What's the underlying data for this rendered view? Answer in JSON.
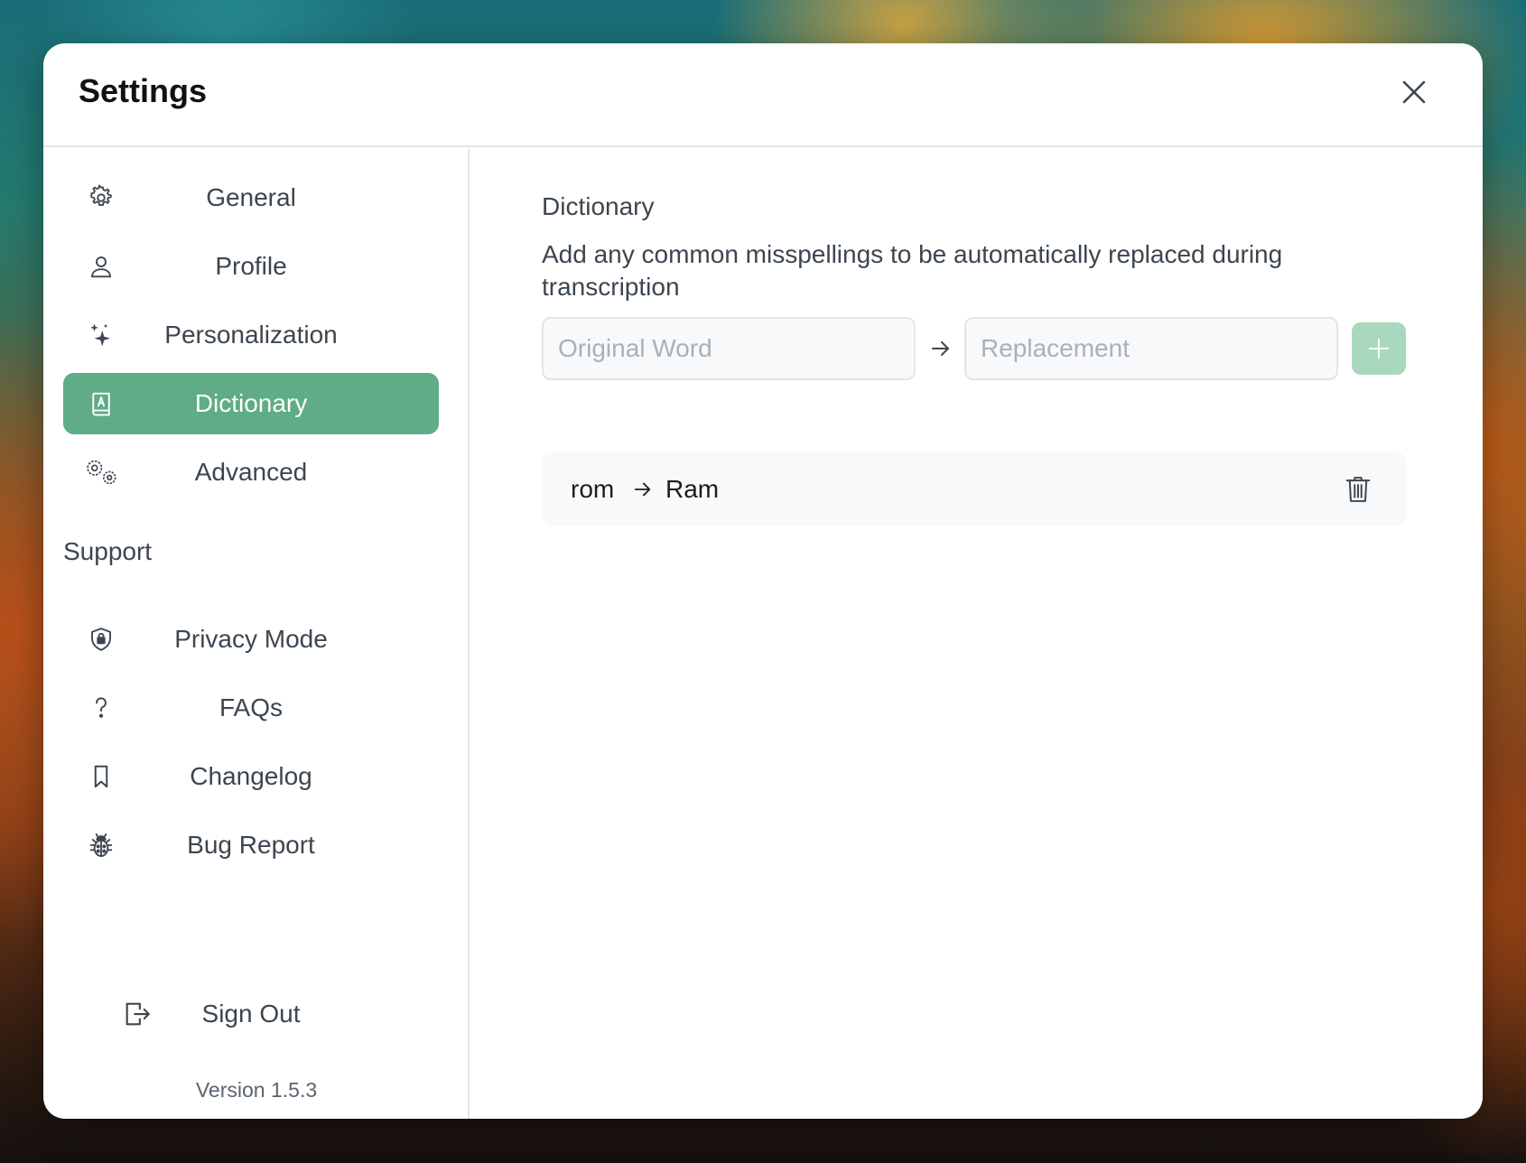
{
  "window": {
    "title": "Settings"
  },
  "sidebar": {
    "items": [
      {
        "label": "General",
        "icon": "gear-icon"
      },
      {
        "label": "Profile",
        "icon": "user-icon"
      },
      {
        "label": "Personalization",
        "icon": "sparkles-icon"
      },
      {
        "label": "Dictionary",
        "icon": "dictionary-book-icon",
        "active": true
      },
      {
        "label": "Advanced",
        "icon": "gears-icon"
      }
    ],
    "support_heading": "Support",
    "support_items": [
      {
        "label": "Privacy Mode",
        "icon": "shield-lock-icon"
      },
      {
        "label": "FAQs",
        "icon": "question-icon"
      },
      {
        "label": "Changelog",
        "icon": "bookmark-icon"
      },
      {
        "label": "Bug Report",
        "icon": "bug-icon"
      }
    ],
    "sign_out": {
      "label": "Sign Out",
      "icon": "sign-out-icon"
    },
    "version": "Version 1.5.3"
  },
  "content": {
    "title": "Dictionary",
    "description": "Add any common misspellings to be automatically replaced during transcription",
    "original_input": {
      "placeholder": "Original Word",
      "value": ""
    },
    "replacement_input": {
      "placeholder": "Replacement",
      "value": ""
    },
    "entries": [
      {
        "original": "rom",
        "replacement": "Ram"
      }
    ]
  },
  "colors": {
    "accent": "#5fac87",
    "accent_disabled": "#a8d8bd",
    "text": "#3c4650",
    "border": "#e3e6e8"
  }
}
